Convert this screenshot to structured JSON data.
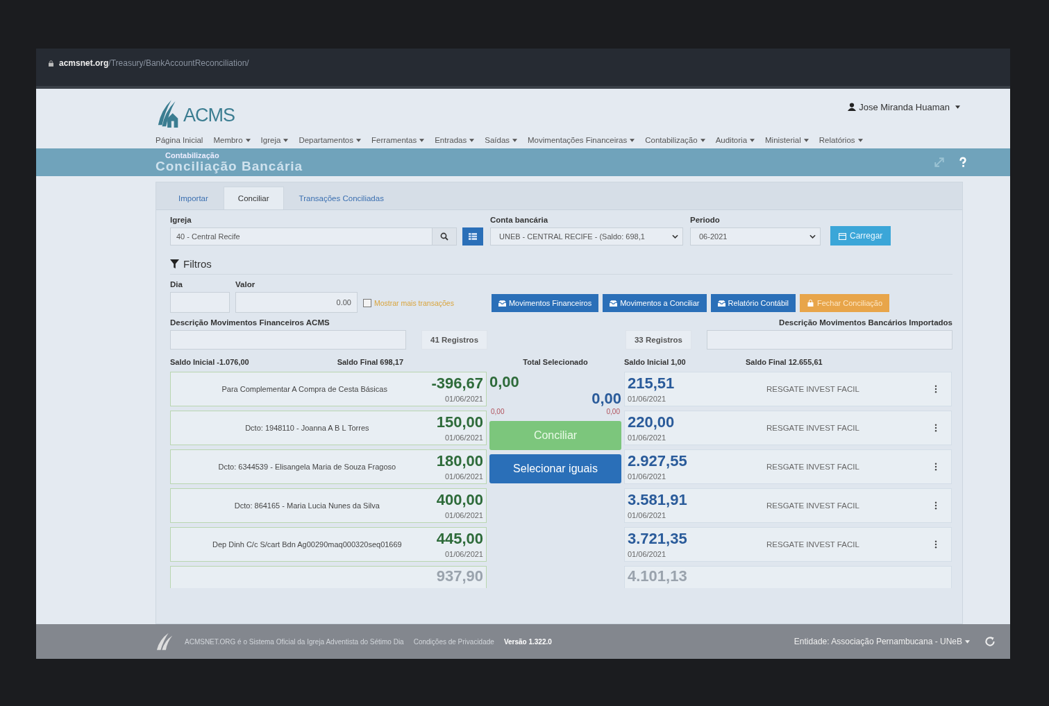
{
  "browser": {
    "host": "acmsnet.org",
    "path": "/Treasury/BankAccountReconciliation/"
  },
  "header": {
    "logo_text": "ACMS",
    "user": "Jose Miranda Huaman"
  },
  "nav": [
    {
      "label": "Página Inicial",
      "dropdown": false
    },
    {
      "label": "Membro",
      "dropdown": true
    },
    {
      "label": "Igreja",
      "dropdown": true
    },
    {
      "label": "Departamentos",
      "dropdown": true
    },
    {
      "label": "Ferramentas",
      "dropdown": true
    },
    {
      "label": "Entradas",
      "dropdown": true
    },
    {
      "label": "Saídas",
      "dropdown": true
    },
    {
      "label": "Movimentações Financeiras",
      "dropdown": true
    },
    {
      "label": "Contabilização",
      "dropdown": true
    },
    {
      "label": "Auditoria",
      "dropdown": true
    },
    {
      "label": "Ministerial",
      "dropdown": true
    },
    {
      "label": "Relatórios",
      "dropdown": true
    }
  ],
  "banner": {
    "section": "Contabilização",
    "title": "Conciliação Bancária"
  },
  "tabs": [
    {
      "label": "Importar",
      "selected": false
    },
    {
      "label": "Conciliar",
      "selected": true
    },
    {
      "label": "Transações Conciliadas",
      "selected": false
    }
  ],
  "form": {
    "church_label": "Igreja",
    "church_value": "40 - Central Recife",
    "account_label": "Conta bancária",
    "account_value": "UNEB - CENTRAL RECIFE - (Saldo: 698,1",
    "period_label": "Periodo",
    "period_value": "06-2021",
    "load_button": "Carregar"
  },
  "filters": {
    "title": "Filtros",
    "day_label": "Dia",
    "value_label": "Valor",
    "value": "0.00",
    "more_checkbox": {
      "label": "Mostrar mais transações",
      "checked": false
    }
  },
  "action_buttons": [
    {
      "label": "Movimentos Financeiros",
      "kind": "primary"
    },
    {
      "label": "Movimentos a Conciliar",
      "kind": "primary"
    },
    {
      "label": "Relatório Contábil",
      "kind": "primary"
    },
    {
      "label": "Fechar Conciliação",
      "kind": "warning"
    }
  ],
  "left": {
    "description_label": "Descrição Movimentos Financeiros ACMS",
    "records": "41 Registros",
    "opening_balance": "Saldo Inicial -1.076,00",
    "closing_balance": "Saldo Final 698,17",
    "items": [
      {
        "description": "Para Complementar A Compra de Cesta Básicas",
        "amount": "-396,67",
        "date": "01/06/2021"
      },
      {
        "description": "Dcto: 1948110 - Joanna A B L Torres",
        "amount": "150,00",
        "date": "01/06/2021"
      },
      {
        "description": "Dcto: 6344539 - Elisangela Maria de Souza Fragoso",
        "amount": "180,00",
        "date": "01/06/2021"
      },
      {
        "description": "Dcto: 864165 - Maria Lucia Nunes da Silva",
        "amount": "400,00",
        "date": "01/06/2021"
      },
      {
        "description": "Dep Dinh C/c S/cart Bdn Ag00290maq000320seq01669",
        "amount": "445,00",
        "date": "01/06/2021"
      },
      {
        "amount": "937,90"
      }
    ]
  },
  "middle": {
    "total_label": "Total Selecionado",
    "left_total": "0,00",
    "right_total": "0,00",
    "left_difference": "0,00",
    "right_difference": "0,00",
    "reconcile_button": "Conciliar",
    "match_button": "Selecionar iguais"
  },
  "right": {
    "description_label": "Descrição Movimentos Bancários Importados",
    "records": "33 Registros",
    "opening_balance": "Saldo Inicial 1,00",
    "closing_balance": "Saldo Final 12.655,61",
    "items": [
      {
        "amount": "215,51",
        "date": "01/06/2021",
        "description": "RESGATE INVEST FACIL"
      },
      {
        "amount": "220,00",
        "date": "01/06/2021",
        "description": "RESGATE INVEST FACIL"
      },
      {
        "amount": "2.927,55",
        "date": "01/06/2021",
        "description": "RESGATE INVEST FACIL"
      },
      {
        "amount": "3.581,91",
        "date": "01/06/2021",
        "description": "RESGATE INVEST FACIL"
      },
      {
        "amount": "3.721,35",
        "date": "01/06/2021",
        "description": "RESGATE INVEST FACIL"
      },
      {
        "amount": "4.101,13"
      }
    ]
  },
  "footer": {
    "notice": "ACMSNET.ORG é o Sistema Oficial da Igreja Adventista do Sétimo Dia",
    "privacy_link": "Condições de Privacidade",
    "version": "Versão 1.322.0",
    "entity": "Entidade: Associação Pernambucana - UNeB"
  }
}
